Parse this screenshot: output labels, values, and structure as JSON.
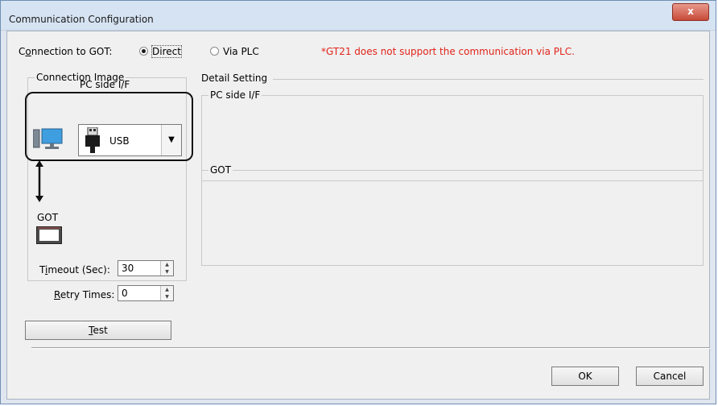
{
  "window": {
    "title": "Communication Configuration",
    "close_glyph": "x"
  },
  "connection": {
    "label": "Connection to GOT:",
    "options": [
      {
        "label": "Direct",
        "selected": true
      },
      {
        "label": "Via PLC",
        "selected": false
      }
    ],
    "warning": "*GT21 does not support the communication via PLC.",
    "warning_color": "#e0241a"
  },
  "connection_image": {
    "legend": "Connection Image",
    "pc_side_label": "PC side I/F",
    "interface_value": "USB",
    "got_label": "GOT",
    "icons": {
      "pc": "pc-monitor-icon",
      "usb": "usb-plug-icon",
      "arrow": "double-arrow-icon",
      "got": "got-panel-icon",
      "dropdown": "chevron-down-icon"
    }
  },
  "timeout": {
    "label_prefix": "T",
    "label_underline": "i",
    "label_rest": "meout (Sec):",
    "value": "30"
  },
  "retry": {
    "label_underline": "R",
    "label_rest": "etry Times:",
    "value": "0"
  },
  "detail": {
    "legend": "Detail Setting",
    "pc_side_legend": "PC side I/F",
    "got_legend": "GOT"
  },
  "buttons": {
    "test_underline": "T",
    "test_rest": "est",
    "ok": "OK",
    "cancel": "Cancel"
  }
}
